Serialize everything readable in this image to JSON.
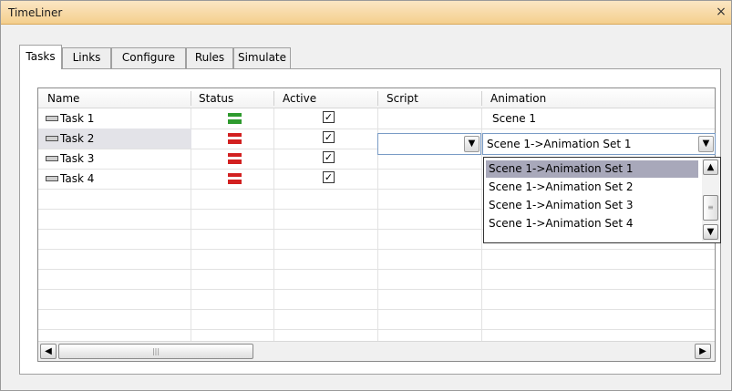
{
  "window": {
    "title": "TimeLiner",
    "close_glyph": "×"
  },
  "tabs": [
    {
      "label": "Tasks",
      "active": true
    },
    {
      "label": "Links",
      "active": false
    },
    {
      "label": "Configure",
      "active": false
    },
    {
      "label": "Rules",
      "active": false
    },
    {
      "label": "Simulate",
      "active": false
    }
  ],
  "columns": [
    "Name",
    "Status",
    "Active",
    "Script",
    "Animation"
  ],
  "rows": [
    {
      "name": "Task 1",
      "status_color": "#2e9a2e",
      "active_glyph": "✓",
      "animation": "Scene 1",
      "selected": false
    },
    {
      "name": "Task 2",
      "status_color": "#d22020",
      "active_glyph": "✓",
      "animation": "",
      "selected": true
    },
    {
      "name": "Task 3",
      "status_color": "#d22020",
      "active_glyph": "✓",
      "animation": "",
      "selected": false
    },
    {
      "name": "Task 4",
      "status_color": "#d22020",
      "active_glyph": "✓",
      "animation": "",
      "selected": false
    }
  ],
  "script_combo": {
    "value": "",
    "icon": "chevron-down-icon"
  },
  "animation_combo": {
    "value": "Scene 1->Animation Set 1",
    "icon": "chevron-down-icon"
  },
  "animation_dropdown": {
    "options": [
      "Scene 1->Animation Set 1",
      "Scene 1->Animation Set 2",
      "Scene 1->Animation Set 3",
      "Scene 1->Animation Set 4"
    ],
    "highlighted": "Scene 1->Animation Set 1"
  },
  "scroll_glyphs": {
    "up": "▲",
    "down": "▼",
    "left": "◀",
    "right": "▶",
    "grip_v": "≡",
    "grip_h": "|||"
  }
}
